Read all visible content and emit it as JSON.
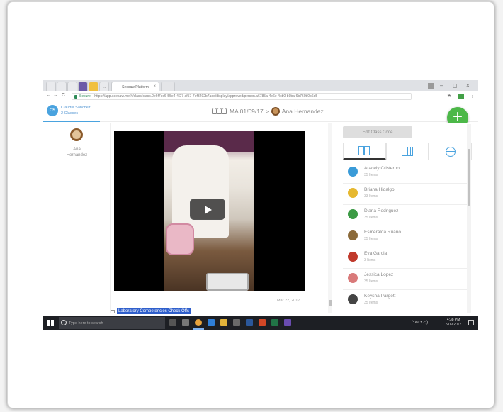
{
  "browser": {
    "tabs": [
      {
        "label": ""
      },
      {
        "label": ""
      },
      {
        "label": ""
      },
      {
        "label": ""
      },
      {
        "label": ""
      },
      {
        "label": "..."
      },
      {
        "label": "Seesaw Platform"
      }
    ],
    "tab_close": "×",
    "window_controls": [
      "–",
      "◻",
      "×"
    ],
    "nav": {
      "back": "←",
      "forward": "→",
      "reload": "C"
    },
    "secure_label": "Secure",
    "url": "https://app.seesaw.me/#/class/class.0e6f7ec6-55e4-4f27-af57-7ef3292b7add/display/approved/person.a6785a-4e6e-4cb0-b9ba-6b760b0b6d5",
    "ext_star": "★"
  },
  "header": {
    "user_initials": "CS",
    "user_name": "Claudia Sanchez",
    "user_sub": "2 Classes",
    "class_name": "MA 01/09/17",
    "separator": ">",
    "student_name": "Ana Hernandez",
    "fab_label": "+"
  },
  "left_panel": {
    "student_first": "Ana",
    "student_last": "Hernandez"
  },
  "post": {
    "date": "Mar 22, 2017",
    "caption": "Laboratory Competencies Check Offs"
  },
  "right_panel": {
    "edit_button": "Edit Class Code",
    "students": [
      {
        "name": "Aracely Cristerno",
        "count": "35 Items",
        "color": "#3a9bd8"
      },
      {
        "name": "Briana Hidalgo",
        "count": "33 Items",
        "color": "#e6b830"
      },
      {
        "name": "Diana Rodriguez",
        "count": "35 Items",
        "color": "#3c9a45"
      },
      {
        "name": "Esmeralda Ruano",
        "count": "35 Items",
        "color": "#8b6a3a"
      },
      {
        "name": "Eva Garcia",
        "count": "3 Items",
        "color": "#c0392b"
      },
      {
        "name": "Jessica Lopez",
        "count": "35 Items",
        "color": "#d97a7a"
      },
      {
        "name": "Keysha Pargett",
        "count": "35 Items",
        "color": "#444444"
      }
    ]
  },
  "taskbar": {
    "search_placeholder": "Type here to search",
    "tray": "^ ✉ ◔ ◁)",
    "time": "4:38 PM",
    "date": "5/09/2017"
  }
}
